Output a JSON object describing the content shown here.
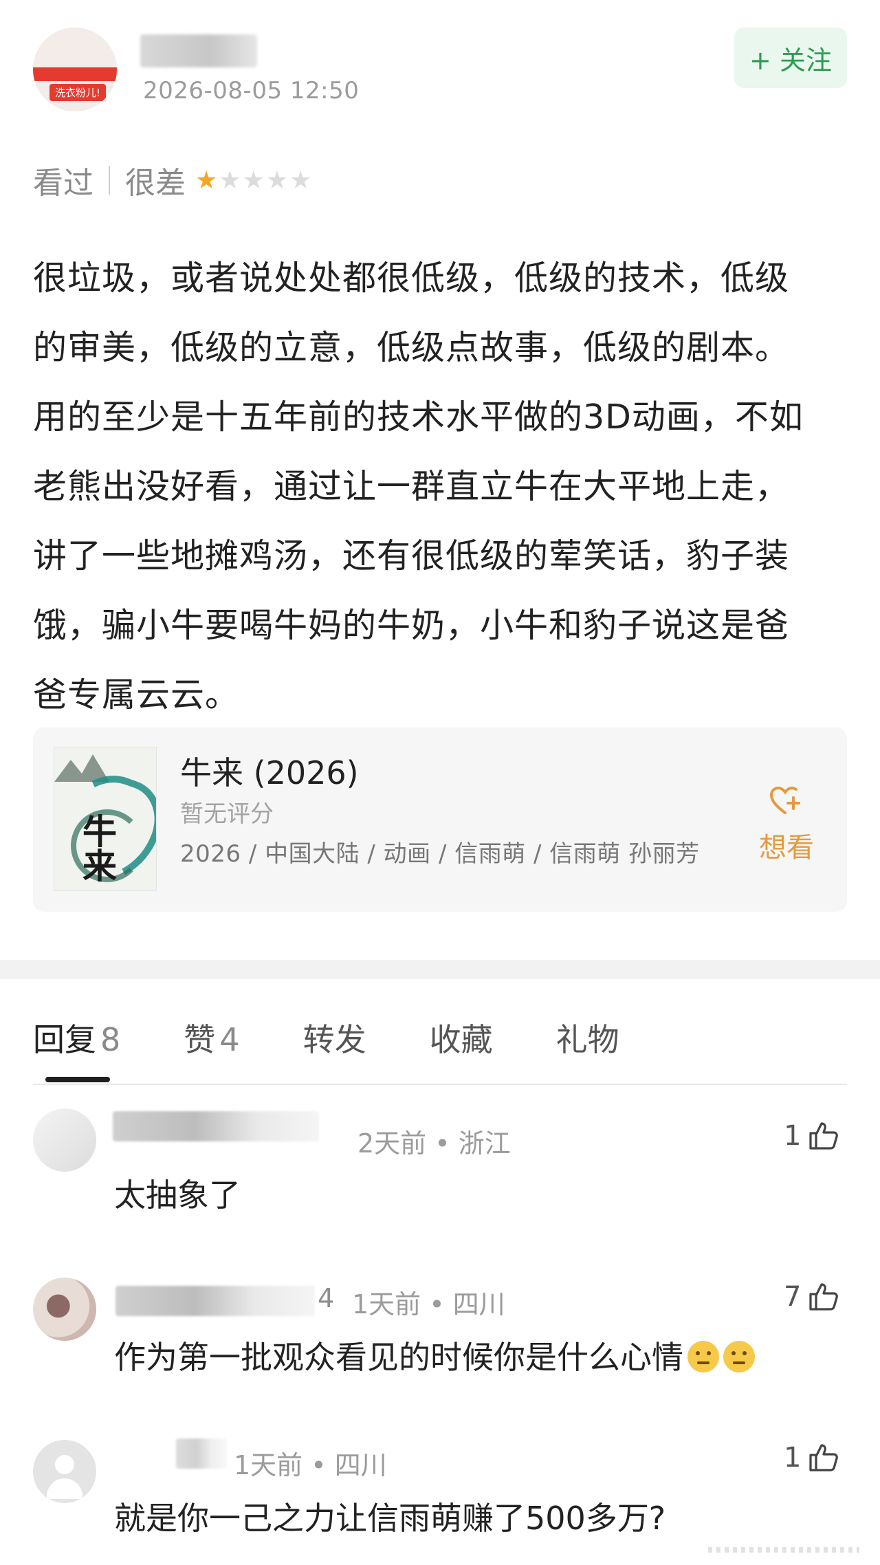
{
  "post": {
    "timestamp": "2026-08-05 12:50",
    "avatar_tag": "洗衣粉儿!",
    "follow_label": "+ 关注"
  },
  "rating": {
    "status": "看过",
    "verdict": "很差",
    "stars_filled": 1,
    "stars_total": 5
  },
  "review": {
    "lines": [
      "很垃圾，或者说处处都很低级，低级的技术，低级",
      "的审美，低级的立意，低级点故事，低级的剧本。",
      "用的至少是十五年前的技术水平做的3D动画，不如",
      "老熊出没好看，通过让一群直立牛在大平地上走，",
      "讲了一些地摊鸡汤，还有很低级的荤笑话，豹子装",
      "饿，骗小牛要喝牛妈的牛奶，小牛和豹子说这是爸",
      "爸专属云云。"
    ]
  },
  "movie": {
    "title": "牛来 (2026)",
    "score": "暂无评分",
    "meta": "2026 / 中国大陆 / 动画 / 信雨萌 / 信雨萌 孙丽芳",
    "want_label": "想看",
    "poster_title": "牛来"
  },
  "tabs": [
    {
      "label": "回复",
      "count": "8"
    },
    {
      "label": "赞",
      "count": "4"
    },
    {
      "label": "转发",
      "count": ""
    },
    {
      "label": "收藏",
      "count": ""
    },
    {
      "label": "礼物",
      "count": ""
    }
  ],
  "comments": [
    {
      "meta": "2天前 • 浙江",
      "text": "太抽象了",
      "likes": "1"
    },
    {
      "name_suffix": "4",
      "meta": "1天前 • 四川",
      "text": "作为第一批观众看见的时候你是什么心情",
      "likes": "7"
    },
    {
      "meta": "1天前 • 四川",
      "text": "就是你一己之力让信雨萌赚了500多万?",
      "likes": "1"
    }
  ],
  "colors": {
    "accent_green": "#2e9b53",
    "follow_bg": "#e9f7ee",
    "star": "#f5a623",
    "want": "#e59a3e"
  },
  "icons": {
    "like": "thumbs-up-icon",
    "want": "heart-plus-icon",
    "default_avatar": "person-icon",
    "emoji": "thinking-face-emoji"
  }
}
